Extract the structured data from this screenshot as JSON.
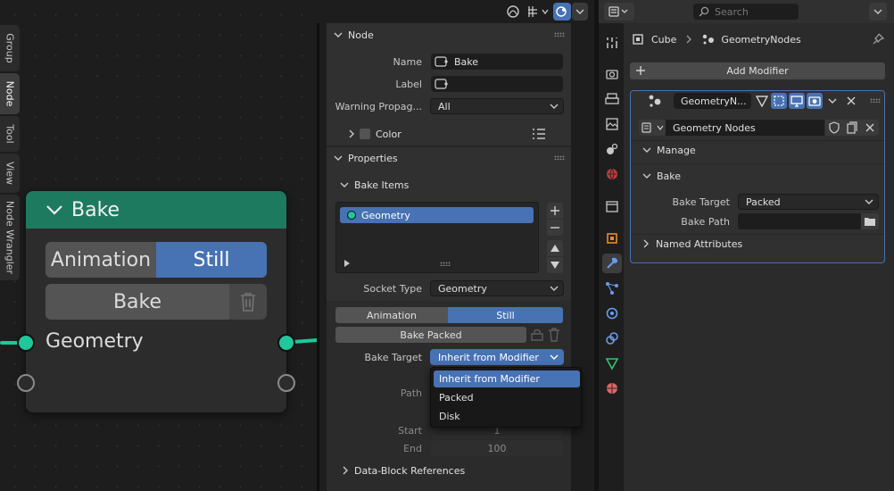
{
  "node": {
    "title": "Bake",
    "mode_animation": "Animation",
    "mode_still": "Still",
    "bake_label": "Bake",
    "socket_label": "Geometry"
  },
  "header": {
    "search_placeholder": "Search"
  },
  "npanel": {
    "node_section": "Node",
    "name_label": "Name",
    "name_value": "Bake",
    "label_label": "Label",
    "label_value": "",
    "warning_label": "Warning Propag...",
    "warning_value": "All",
    "color_label": "Color",
    "properties_section": "Properties",
    "bake_items_section": "Bake Items",
    "bake_item": "Geometry",
    "socket_type_label": "Socket Type",
    "socket_type_value": "Geometry",
    "mode_animation": "Animation",
    "mode_still": "Still",
    "bake_packed": "Bake Packed",
    "bake_target_label": "Bake Target",
    "bake_target_value": "Inherit from Modifier",
    "path_label": "Path",
    "start_label": "Start",
    "start_value": "1",
    "end_label": "End",
    "end_value": "100",
    "data_block_refs": "Data-Block References"
  },
  "vtabs": [
    "Group",
    "Node",
    "Tool",
    "View",
    "Node Wrangler"
  ],
  "menu": {
    "items": [
      "Inherit from Modifier",
      "Packed",
      "Disk"
    ],
    "selected": 0
  },
  "props": {
    "breadcrumb_object": "Cube",
    "breadcrumb_modifier": "GeometryNodes",
    "add_modifier": "Add Modifier",
    "modifier_name": "GeometryN...",
    "node_group": "Geometry Nodes",
    "manage_section": "Manage",
    "bake_section": "Bake",
    "bake_target_label": "Bake Target",
    "bake_target_value": "Packed",
    "bake_path_label": "Bake Path",
    "bake_path_value": "",
    "named_attributes": "Named Attributes"
  },
  "colors": {
    "accent": "#4772b3",
    "node_header": "#1e7a5f",
    "socket_geometry": "#1fc79a"
  }
}
